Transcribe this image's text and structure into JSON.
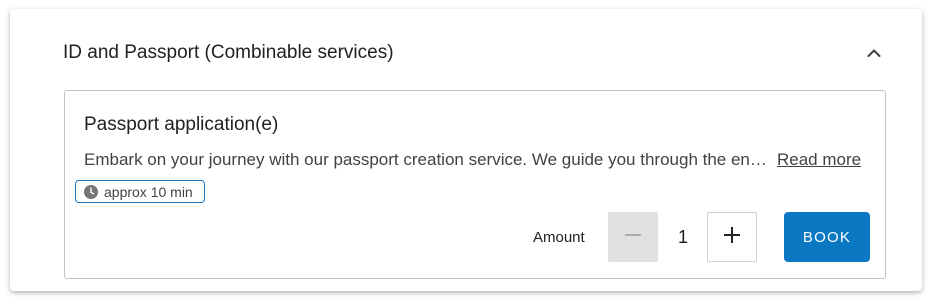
{
  "panel": {
    "title": "ID and Passport (Combinable services)",
    "collapse_icon": "chevron-up-icon"
  },
  "service": {
    "title": "Passport application(e)",
    "description": "Embark on your journey with our passport creation service. We guide you through the entire process",
    "read_more_label": "Read more",
    "duration": {
      "icon": "clock-icon",
      "label": "approx 10 min"
    },
    "amount": {
      "label": "Amount",
      "value": "1",
      "decrement_icon": "minus-icon",
      "increment_icon": "plus-icon"
    },
    "book_label": "BOOK"
  },
  "colors": {
    "accent": "#0b78c4",
    "badge_border": "#1a73b8",
    "disabled_button": "#e0e0e0",
    "card_border": "#c4c4c4"
  }
}
